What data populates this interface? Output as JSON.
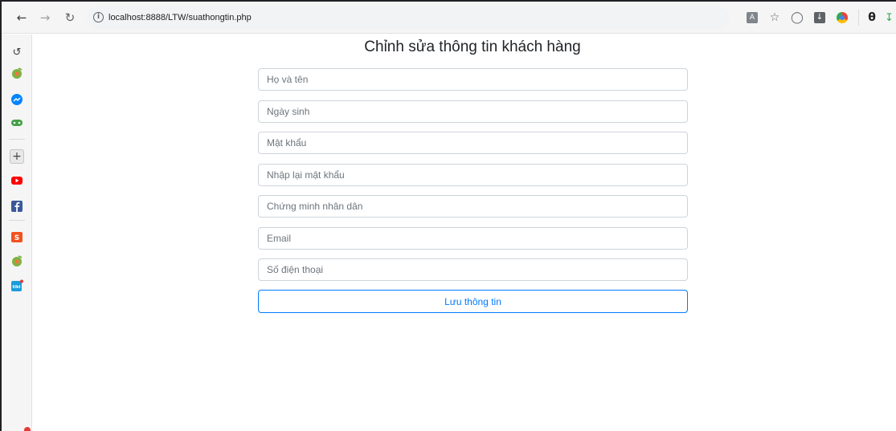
{
  "browser": {
    "url": "localhost:8888/LTW/suathongtin.php",
    "nav": {
      "back_icon": "arrow-left-icon",
      "forward_icon": "arrow-right-icon",
      "reload_icon": "reload-icon"
    },
    "extensions": [
      "translate-icon",
      "star-icon",
      "shield-icon",
      "download-box-icon",
      "chrome-ext-icon",
      "profile-icon",
      "download-arrow-icon"
    ]
  },
  "sidebar": {
    "items": [
      {
        "name": "history-icon"
      },
      {
        "name": "green-ext-icon"
      },
      {
        "name": "messenger-icon"
      },
      {
        "name": "gamepad-icon"
      },
      {
        "name": "add-icon"
      },
      {
        "name": "youtube-icon"
      },
      {
        "name": "facebook-icon"
      },
      {
        "name": "shopee-icon"
      },
      {
        "name": "green-ext-icon-2"
      },
      {
        "name": "tiki-icon"
      }
    ]
  },
  "page": {
    "title": "Chỉnh sửa thông tin khách hàng",
    "fields": {
      "fullname": {
        "placeholder": "Họ và tên",
        "value": ""
      },
      "birthday": {
        "placeholder": "Ngày sinh",
        "value": ""
      },
      "password": {
        "placeholder": "Mật khẩu",
        "value": ""
      },
      "password_confirm": {
        "placeholder": "Nhập lại mật khẩu",
        "value": ""
      },
      "id_card": {
        "placeholder": "Chứng minh nhân dân",
        "value": ""
      },
      "email": {
        "placeholder": "Email",
        "value": ""
      },
      "phone": {
        "placeholder": "Số điện thoại",
        "value": ""
      }
    },
    "save_label": "Lưu thông tin"
  },
  "colors": {
    "accent": "#007bff",
    "border": "#ced4da",
    "title": "#212529",
    "toolbar_bg": "#f5f5f5"
  }
}
